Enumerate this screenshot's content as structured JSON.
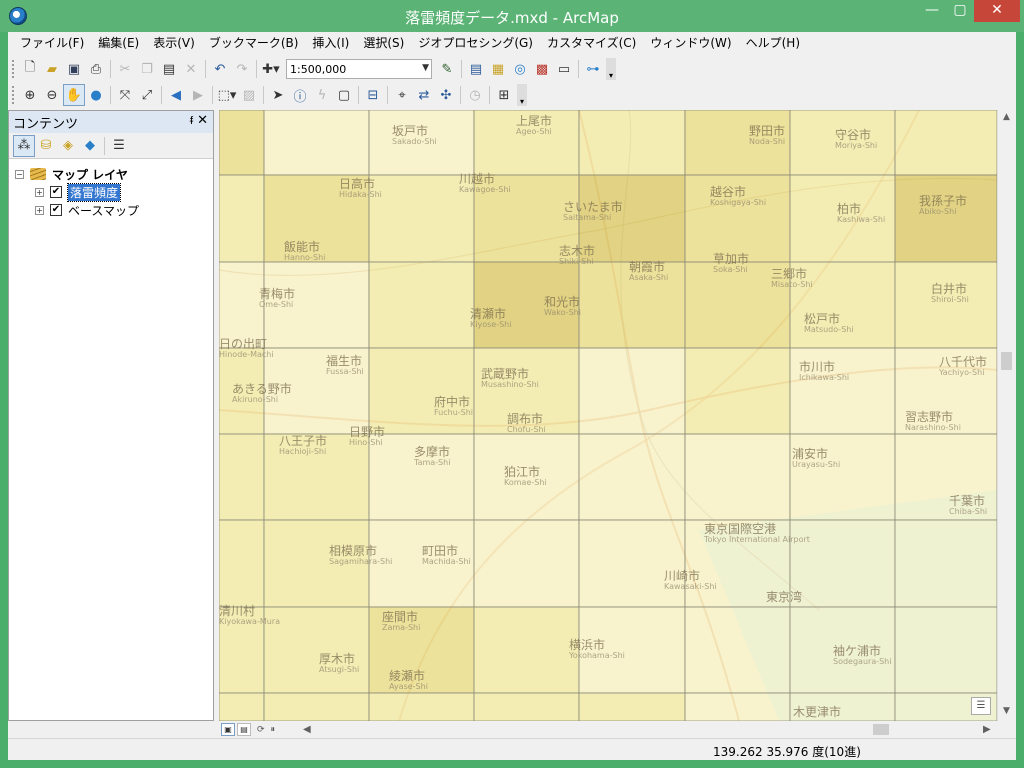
{
  "window": {
    "title": "落雷頻度データ.mxd - ArcMap",
    "minimize": "—",
    "maximize": "▢",
    "close": "✕"
  },
  "menu": [
    "ファイル(F)",
    "編集(E)",
    "表示(V)",
    "ブックマーク(B)",
    "挿入(I)",
    "選択(S)",
    "ジオプロセシング(G)",
    "カスタマイズ(C)",
    "ウィンドウ(W)",
    "ヘルプ(H)"
  ],
  "toolbar": {
    "scale": "1:500,000"
  },
  "toc": {
    "title": "コンテンツ",
    "pin": "ᵮ",
    "close": "✕",
    "root_label": "マップ レイヤ",
    "layers": [
      {
        "label": "落雷頻度",
        "checked": true,
        "selected": true
      },
      {
        "label": "ベースマップ",
        "checked": true,
        "selected": false
      }
    ]
  },
  "status": {
    "coordinates": "139.262  35.976 度(10進)"
  },
  "map": {
    "grid_colors": {
      "level1": "#fbf7c2",
      "level2": "#f4ec9c",
      "level3": "#e8dc7b",
      "level4": "#d8c85f"
    },
    "grid": [
      [
        3,
        1,
        1,
        2,
        2,
        3,
        2,
        2,
        1,
        2,
        1
      ],
      [
        2,
        3,
        2,
        3,
        4,
        3,
        2,
        4,
        3,
        2,
        1
      ],
      [
        1,
        1,
        2,
        4,
        3,
        3,
        2,
        2,
        3,
        3,
        2
      ],
      [
        2,
        1,
        2,
        2,
        1,
        2,
        1,
        1,
        2,
        3,
        2
      ],
      [
        2,
        2,
        1,
        1,
        1,
        1,
        1,
        1,
        1,
        2,
        2
      ],
      [
        2,
        2,
        1,
        1,
        1,
        1,
        1,
        1,
        1,
        1,
        1
      ],
      [
        2,
        2,
        3,
        2,
        1,
        1,
        1,
        1,
        1,
        1,
        1
      ],
      [
        2,
        2,
        2,
        2,
        2,
        1,
        1,
        1,
        1,
        1,
        1
      ],
      [
        2,
        1,
        1,
        1,
        3,
        1,
        1,
        1,
        1,
        1,
        1
      ]
    ],
    "labels": [
      {
        "text": "坂戸市",
        "sub": "Sakado-Shi"
      },
      {
        "text": "上尾市",
        "sub": "Ageo-Shi"
      },
      {
        "text": "野田市",
        "sub": "Noda-Shi"
      },
      {
        "text": "守谷市",
        "sub": "Moriya-Shi"
      },
      {
        "text": "日高市",
        "sub": "Hidaka-Shi"
      },
      {
        "text": "川越市",
        "sub": "Kawagoe-Shi"
      },
      {
        "text": "さいたま市",
        "sub": "Saitama-Shi"
      },
      {
        "text": "越谷市",
        "sub": "Koshigaya-Shi"
      },
      {
        "text": "柏市",
        "sub": "Kashiwa-Shi"
      },
      {
        "text": "我孫子市",
        "sub": "Abiko-Shi"
      },
      {
        "text": "飯能市",
        "sub": "Hanno-Shi"
      },
      {
        "text": "志木市",
        "sub": "Shiki-Shi"
      },
      {
        "text": "草加市",
        "sub": "Soka-Shi"
      },
      {
        "text": "青梅市",
        "sub": "Ome-Shi"
      },
      {
        "text": "朝霞市",
        "sub": "Asaka-Shi"
      },
      {
        "text": "三郷市",
        "sub": "Misato-Shi"
      },
      {
        "text": "白井市",
        "sub": "Shiroi-Shi"
      },
      {
        "text": "和光市",
        "sub": "Wako-Shi"
      },
      {
        "text": "清瀬市",
        "sub": "Kiyose-Shi"
      },
      {
        "text": "松戸市",
        "sub": "Matsudo-Shi"
      },
      {
        "text": "日の出町",
        "sub": "Hinode-Machi"
      },
      {
        "text": "福生市",
        "sub": "Fussa-Shi"
      },
      {
        "text": "武蔵野市",
        "sub": "Musashino-Shi"
      },
      {
        "text": "市川市",
        "sub": "Ichikawa-Shi"
      },
      {
        "text": "八千代市",
        "sub": "Yachiyo-Shi"
      },
      {
        "text": "あきる野市",
        "sub": "Akiruno-Shi"
      },
      {
        "text": "府中市",
        "sub": "Fuchu-Shi"
      },
      {
        "text": "調布市",
        "sub": "Chofu-Shi"
      },
      {
        "text": "習志野市",
        "sub": "Narashino-Shi"
      },
      {
        "text": "八王子市",
        "sub": "Hachioji-Shi"
      },
      {
        "text": "日野市",
        "sub": "Hino-Shi"
      },
      {
        "text": "多摩市",
        "sub": "Tama-Shi"
      },
      {
        "text": "狛江市",
        "sub": "Komae-Shi"
      },
      {
        "text": "浦安市",
        "sub": "Urayasu-Shi"
      },
      {
        "text": "千葉市",
        "sub": "Chiba-Shi"
      },
      {
        "text": "東京国際空港",
        "sub": "Tokyo International Airport"
      },
      {
        "text": "相模原市",
        "sub": "Sagamihara-Shi"
      },
      {
        "text": "町田市",
        "sub": "Machida-Shi"
      },
      {
        "text": "川崎市",
        "sub": "Kawasaki-Shi"
      },
      {
        "text": "東京湾",
        "sub": ""
      },
      {
        "text": "清川村",
        "sub": "Kiyokawa-Mura"
      },
      {
        "text": "座間市",
        "sub": "Zama-Shi"
      },
      {
        "text": "横浜市",
        "sub": "Yokohama-Shi"
      },
      {
        "text": "袖ケ浦市",
        "sub": "Sodegaura-Shi"
      },
      {
        "text": "厚木市",
        "sub": "Atsugi-Shi"
      },
      {
        "text": "綾瀬市",
        "sub": "Ayase-Shi"
      },
      {
        "text": "木更津市",
        "sub": ""
      }
    ]
  }
}
